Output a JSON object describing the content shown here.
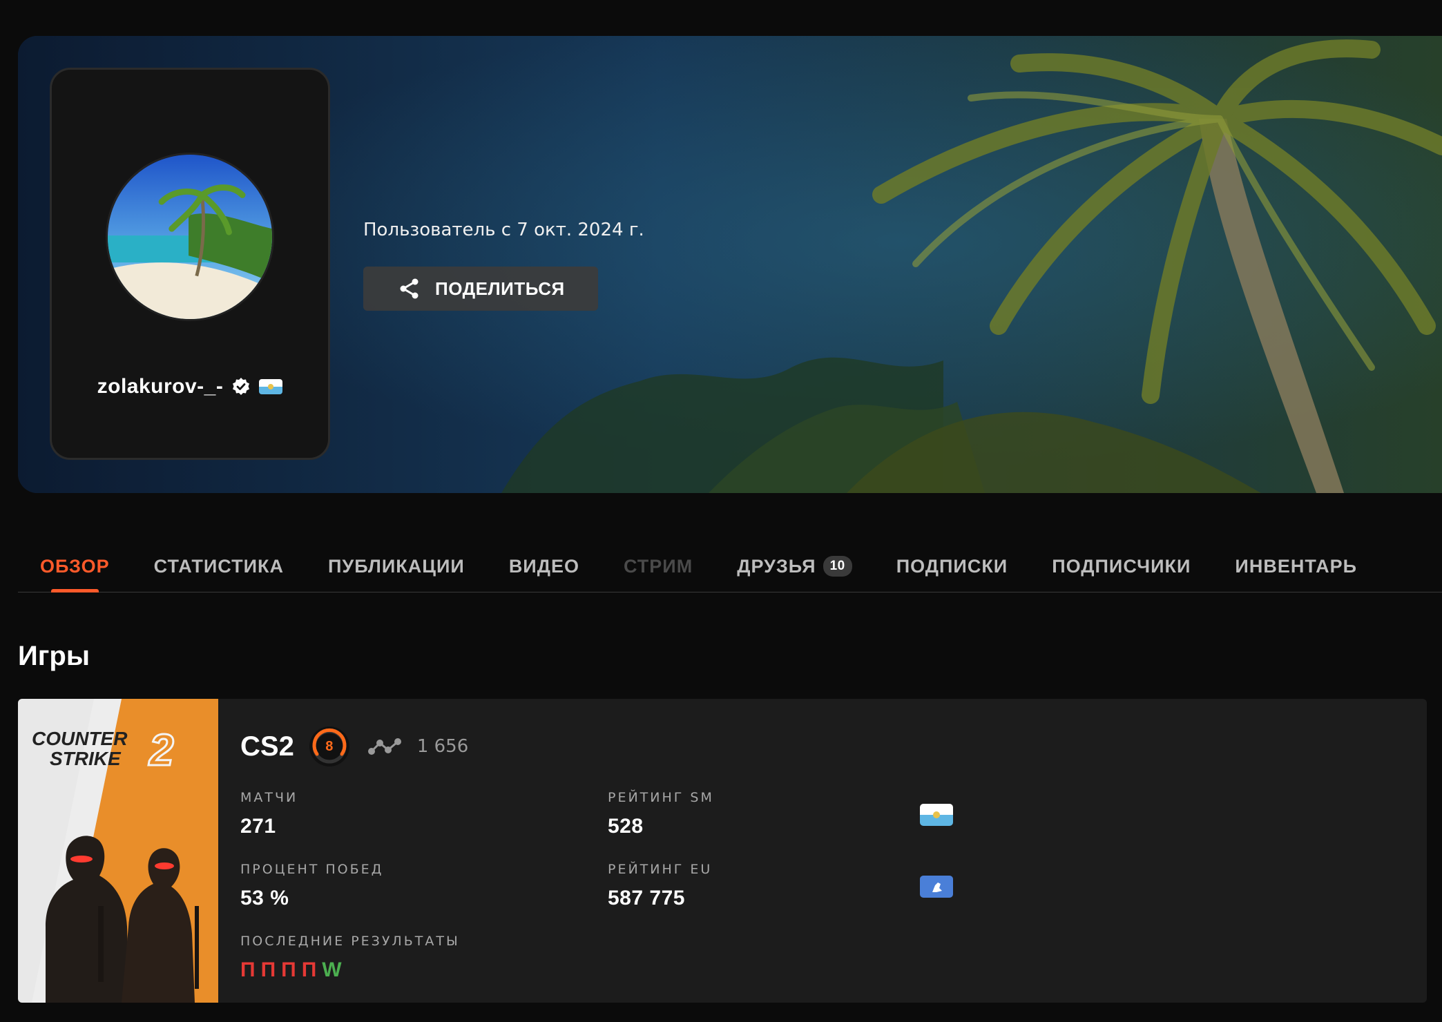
{
  "profile": {
    "username": "zolakurov-_-",
    "member_since": "Пользователь с 7 окт. 2024 г.",
    "share_label": "ПОДЕЛИТЬСЯ",
    "verified_icon": "verified-badge-icon",
    "country_flag": "san-marino-flag-icon"
  },
  "tabs": [
    {
      "label": "ОБЗОР",
      "state": "active"
    },
    {
      "label": "СТАТИСТИКА",
      "state": "normal"
    },
    {
      "label": "ПУБЛИКАЦИИ",
      "state": "normal"
    },
    {
      "label": "ВИДЕО",
      "state": "normal"
    },
    {
      "label": "СТРИМ",
      "state": "disabled"
    },
    {
      "label": "ДРУЗЬЯ",
      "state": "normal",
      "badge": "10"
    },
    {
      "label": "ПОДПИСКИ",
      "state": "normal"
    },
    {
      "label": "ПОДПИСЧИКИ",
      "state": "normal"
    },
    {
      "label": "ИНВЕНТАРЬ",
      "state": "normal"
    }
  ],
  "games": {
    "title": "Игры",
    "cover_logo_line1": "COUNTER",
    "cover_logo_line2": "STRIKE",
    "cover_logo_number": "2",
    "items": [
      {
        "name": "CS2",
        "level": "8",
        "elo": "1 656",
        "stats": {
          "matches_label": "МАТЧИ",
          "matches_value": "271",
          "rating_sm_label": "РЕЙТИНГ SM",
          "rating_sm_value": "528",
          "winrate_label": "ПРОЦЕНТ ПОБЕД",
          "winrate_value": "53 %",
          "rating_eu_label": "РЕЙТИНГ EU",
          "rating_eu_value": "587 775",
          "recent_label": "ПОСЛЕДНИЕ РЕЗУЛЬТАТЫ",
          "recent_results": [
            "П",
            "П",
            "П",
            "П",
            "W"
          ]
        }
      }
    ]
  },
  "colors": {
    "accent": "#ff5a2a",
    "loss": "#e53935",
    "win": "#4caf50",
    "background": "#0b0b0b",
    "card": "#1c1c1c"
  }
}
